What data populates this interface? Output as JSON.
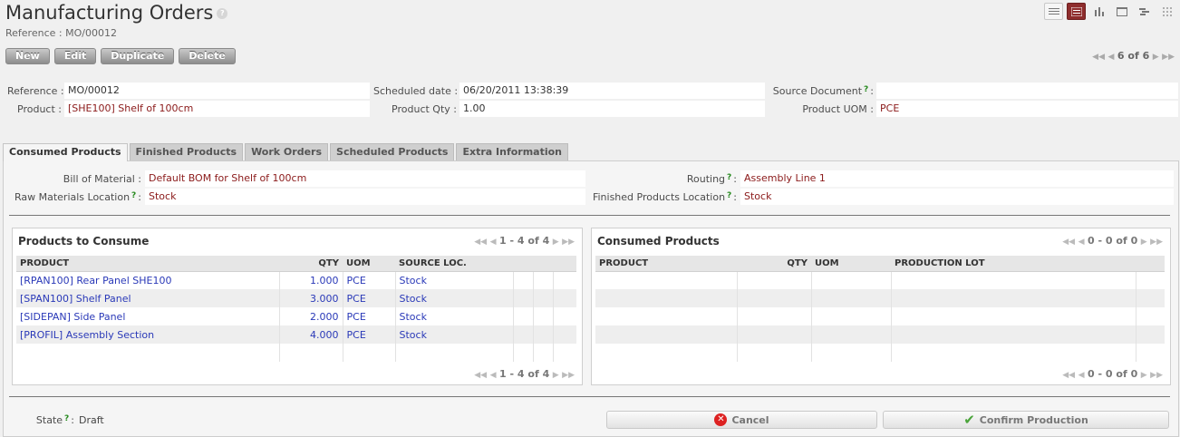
{
  "header": {
    "title": "Manufacturing Orders",
    "help_icon": "?",
    "breadcrumb": "Reference : MO/00012"
  },
  "view_switcher": [
    {
      "name": "list-view",
      "icon": "list-icon"
    },
    {
      "name": "form-view",
      "icon": "form-icon",
      "active": true
    },
    {
      "name": "graph-view",
      "icon": "bar-chart-icon"
    },
    {
      "name": "calendar-view",
      "icon": "calendar-icon"
    },
    {
      "name": "gantt-view",
      "icon": "gantt-icon"
    },
    {
      "name": "diagram-view",
      "icon": "dots-grid-icon"
    }
  ],
  "toolbar": {
    "new_label": "New",
    "edit_label": "Edit",
    "duplicate_label": "Duplicate",
    "delete_label": "Delete",
    "pager": "6 of 6"
  },
  "form": {
    "reference_label": "Reference :",
    "reference_value": "MO/00012",
    "scheduled_date_label": "Scheduled date :",
    "scheduled_date_value": "06/20/2011 13:38:39",
    "source_document_label": "Source Document",
    "source_document_value": "",
    "product_label": "Product :",
    "product_value": "[SHE100] Shelf of 100cm",
    "product_qty_label": "Product Qty :",
    "product_qty_value": "1.00",
    "product_uom_label": "Product UOM :",
    "product_uom_value": "PCE"
  },
  "tabs": [
    {
      "label": "Consumed Products",
      "active": true
    },
    {
      "label": "Finished Products"
    },
    {
      "label": "Work Orders"
    },
    {
      "label": "Scheduled Products"
    },
    {
      "label": "Extra Information"
    }
  ],
  "consumed_tab": {
    "bom_label": "Bill of Material :",
    "bom_value": "Default BOM for Shelf of 100cm",
    "raw_loc_label": "Raw Materials Location",
    "raw_loc_value": "Stock",
    "routing_label": "Routing",
    "routing_value": "Assembly Line 1",
    "finished_loc_label": "Finished Products Location",
    "finished_loc_value": "Stock"
  },
  "products_to_consume": {
    "title": "Products to Consume",
    "pager": "1 - 4 of 4",
    "columns": [
      "PRODUCT",
      "QTY",
      "UOM",
      "SOURCE LOC."
    ],
    "rows": [
      {
        "product": "[RPAN100] Rear Panel SHE100",
        "qty": "1.000",
        "uom": "PCE",
        "loc": "Stock"
      },
      {
        "product": "[SPAN100] Shelf Panel",
        "qty": "3.000",
        "uom": "PCE",
        "loc": "Stock"
      },
      {
        "product": "[SIDEPAN] Side Panel",
        "qty": "2.000",
        "uom": "PCE",
        "loc": "Stock"
      },
      {
        "product": "[PROFIL] Assembly Section",
        "qty": "4.000",
        "uom": "PCE",
        "loc": "Stock"
      }
    ]
  },
  "consumed_products": {
    "title": "Consumed Products",
    "pager": "0 - 0 of 0",
    "columns": [
      "PRODUCT",
      "QTY",
      "UOM",
      "PRODUCTION LOT"
    ]
  },
  "footer": {
    "state_label": "State",
    "state_value": "Draft",
    "cancel_label": "Cancel",
    "confirm_label": "Confirm Production"
  },
  "colors": {
    "active_view": "#8e2d2d",
    "link_blue": "#2a39b8",
    "required_red": "#8b1a1a",
    "help_green": "#268a1e"
  }
}
